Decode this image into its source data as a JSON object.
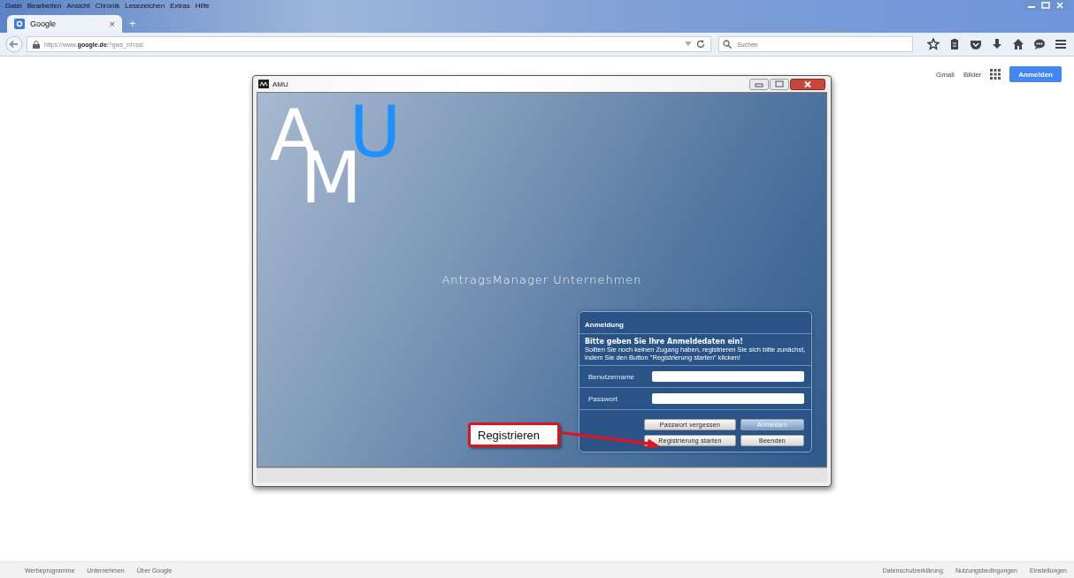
{
  "browser": {
    "menu": [
      "Datei",
      "Bearbeiten",
      "Ansicht",
      "Chronik",
      "Lesezeichen",
      "Extras",
      "Hilfe"
    ],
    "tabs": [
      {
        "label": "Google",
        "selected": true,
        "close": "×"
      }
    ],
    "new_tab": "+",
    "url": "https://www.**google.de**/?gws_rd=ssl",
    "search": {
      "placeholder": "Suchen"
    }
  },
  "google_header": {
    "links": [
      "Gmail",
      "Bilder"
    ],
    "sign_in": "Anmelden"
  },
  "app_window": {
    "title": "AMU",
    "logo": [
      {
        "text": "A",
        "color": "#ffffff"
      },
      {
        "text": "M",
        "color": "#ffffff"
      },
      {
        "text": "U",
        "color": "#1e90ff"
      }
    ],
    "subtitle": "AntragsManager Unternehmen",
    "login": {
      "title": "Anmeldung",
      "heading": "Bitte geben Sie Ihre Anmeldedaten ein!",
      "text": "Sollten Sie noch keinen Zugang haben, registrieren Sie sich bitte zunächst, indem Sie den Button \"Registrierung starten\" klicken!",
      "fields": [
        {
          "label": "Benutzername"
        },
        {
          "label": "Passwort"
        }
      ],
      "buttons": [
        {
          "label": "Passwort vergessen",
          "kind": "plain"
        },
        {
          "label": "Anmelden",
          "kind": "primary"
        },
        {
          "label": "Registrierung starten",
          "kind": "plain"
        },
        {
          "label": "Beenden",
          "kind": "plain"
        }
      ]
    },
    "callout": {
      "text": "Registrieren"
    }
  },
  "footer": {
    "left": [
      "Werbeprogramme",
      "Unternehmen",
      "Über Google"
    ],
    "right": [
      "Datenschutzerklärung",
      "Nutzungsbedingungen",
      "Einstellungen"
    ]
  }
}
